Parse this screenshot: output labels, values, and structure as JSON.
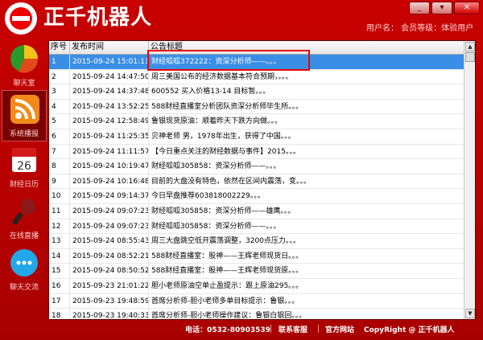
{
  "app": {
    "title": "正千机器人",
    "user_info": "用户名：  会员等级：体验用户"
  },
  "window": {
    "minimize": "_",
    "menu": "▾",
    "close": "✕"
  },
  "sidebar": {
    "items": [
      {
        "label": "聊天室"
      },
      {
        "label": "系统播报"
      },
      {
        "label": "财经日历"
      },
      {
        "label": "在线直播"
      },
      {
        "label": "聊天交流"
      }
    ]
  },
  "table": {
    "headers": [
      "序号",
      "发布时间",
      "公告标题"
    ],
    "rows": [
      [
        "1",
        "2015-09-24 15:01:11",
        "财经呱呱372222：资深分析师——。。。"
      ],
      [
        "2",
        "2015-09-24 14:47:50",
        "周三美国公布的经济数据基本符合预期，。。。"
      ],
      [
        "3",
        "2015-09-24 14:37:48",
        "600552 买入价格13-14 目标暂。。。"
      ],
      [
        "4",
        "2015-09-24 13:52:25",
        "588财经直播室分析团队资深分析师毕生所。。。"
      ],
      [
        "5",
        "2015-09-24 12:58:49",
        "鲁银现货原油：顺着昨天下跌方向做。。。"
      ],
      [
        "6",
        "2015-09-24 11:25:35",
        "贝神老师 男，1978年出生，获得了中国。。。"
      ],
      [
        "7",
        "2015-09-24 11:11:57",
        "【今日重点关注的财经数据与事件】2015。。。"
      ],
      [
        "8",
        "2015-09-24 10:19:47",
        "财经呱呱305858：资深分析师——。。。"
      ],
      [
        "9",
        "2015-09-24 10:16:48",
        "目前的大盘没有特色，依然在区间内震荡，变。。。"
      ],
      [
        "10",
        "2015-09-24 09:14:37",
        "今日早盘推荐603818002229。。。"
      ],
      [
        "11",
        "2015-09-24 09:07:23",
        "财经呱呱305858：资深分析师——雄鹰。。。"
      ],
      [
        "12",
        "2015-09-24 09:07:23",
        "财经呱呱305858：资深分析师——。。。"
      ],
      [
        "13",
        "2015-09-24 08:55:43",
        "周三大盘跳空低开震荡调整，3200点压力。。。"
      ],
      [
        "14",
        "2015-09-24 08:52:21",
        "588财经直播室：股神——王辉老师现货日。。。"
      ],
      [
        "15",
        "2015-09-24 08:50:52",
        "588财经直播室：股神——王辉老师现货原。。。"
      ],
      [
        "16",
        "2015-09-23 21:01:22",
        "胆小老师原油空单止盈提示：跟上原油295。。。"
      ],
      [
        "17",
        "2015-09-23 19:48:59",
        "首席分析师-胆小老师多单目标提示：鲁银。。。"
      ],
      [
        "18",
        "2015-09-23 19:40:33",
        "首席分析师-胆小老师操作建议：鲁银白银回。。。"
      ]
    ]
  },
  "footer": {
    "phone": "电话：0532-80903539",
    "contact": "联系客服",
    "website": "官方网站",
    "copyright": "CopyRight @ 正千机器人"
  },
  "colors": {
    "brand_red": "#c80000",
    "selection": "#3a8ee6",
    "highlight_box": "#e00000"
  }
}
